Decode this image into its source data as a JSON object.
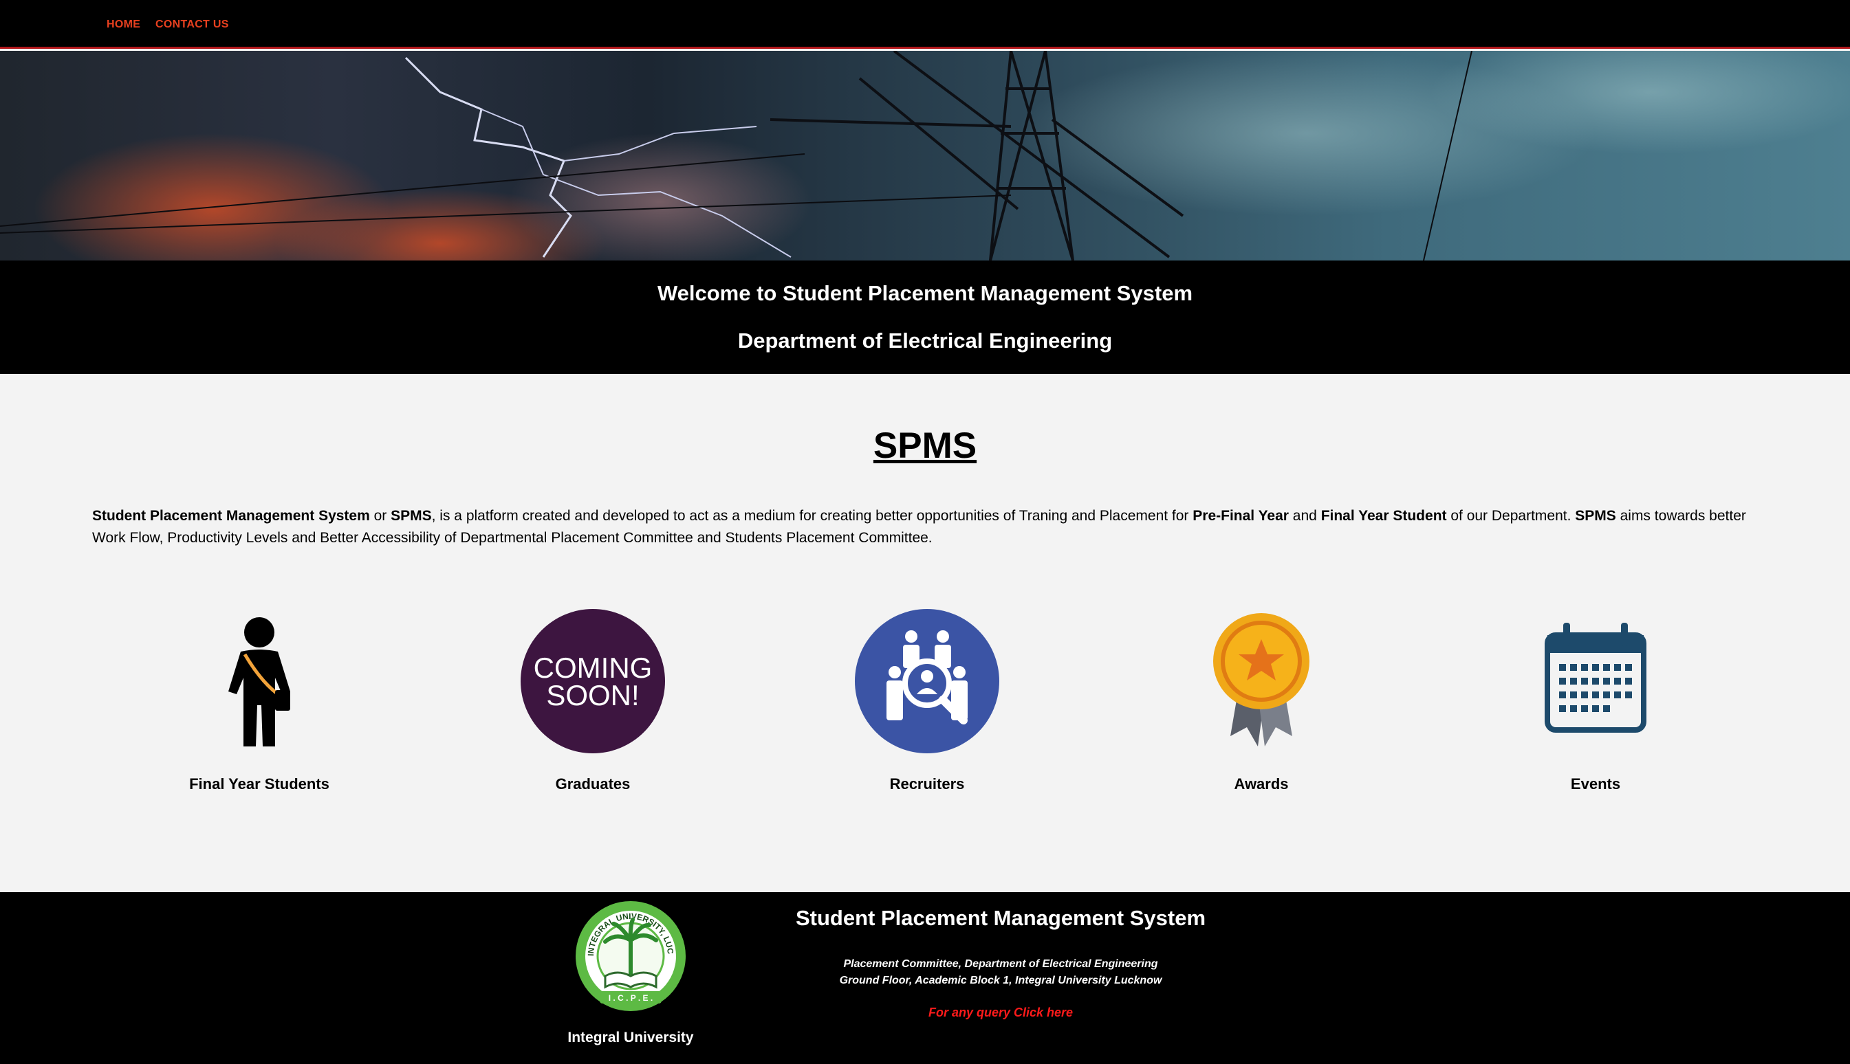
{
  "nav": {
    "home": "HOME",
    "contact": "CONTACT US"
  },
  "welcome": {
    "line1": "Welcome to Student Placement Management System",
    "line2": "Department of Electrical Engineering"
  },
  "main": {
    "title": "SPMS",
    "intro": {
      "p1": "Student Placement Management System",
      "p2": " or ",
      "p3": "SPMS",
      "p4": ", is a platform created and developed to act as a medium for creating better opportunities of Traning and Placement for ",
      "p5": "Pre-Final Year",
      "p6": " and ",
      "p7": "Final Year Student",
      "p8": " of our Department. ",
      "p9": "SPMS",
      "p10": " aims towards better Work Flow, Productivity Levels and Better Accessibility of Departmental Placement Committee and Students Placement Committee."
    },
    "cards": [
      {
        "label": "Final Year Students",
        "icon": "student-icon"
      },
      {
        "label": "Graduates",
        "icon": "coming-soon-icon",
        "badge_line1": "COMING",
        "badge_line2": "SOON!"
      },
      {
        "label": "Recruiters",
        "icon": "recruiters-icon"
      },
      {
        "label": "Awards",
        "icon": "award-medal-icon"
      },
      {
        "label": "Events",
        "icon": "calendar-icon"
      }
    ]
  },
  "footer": {
    "title": "Student Placement Management System",
    "line1": "Placement Committee, Department of Electrical Engineering",
    "line2": "Ground Floor, Academic Block 1, Integral University Lucknow",
    "query": "For any query Click here",
    "university": "Integral University",
    "logo": {
      "ring_text": "INTEGRAL UNIVERSITY, LUCKNOW",
      "bottom_text": "I . C . P . E ."
    }
  },
  "colors": {
    "nav_link": "#e8401f",
    "nav_border": "#b2161a",
    "query_link": "#ff1a1a",
    "coming_soon_bg": "#3d1540",
    "recruiters_bg": "#3b54a5",
    "calendar": "#1d4a6b",
    "award_gold": "#f0a818"
  }
}
